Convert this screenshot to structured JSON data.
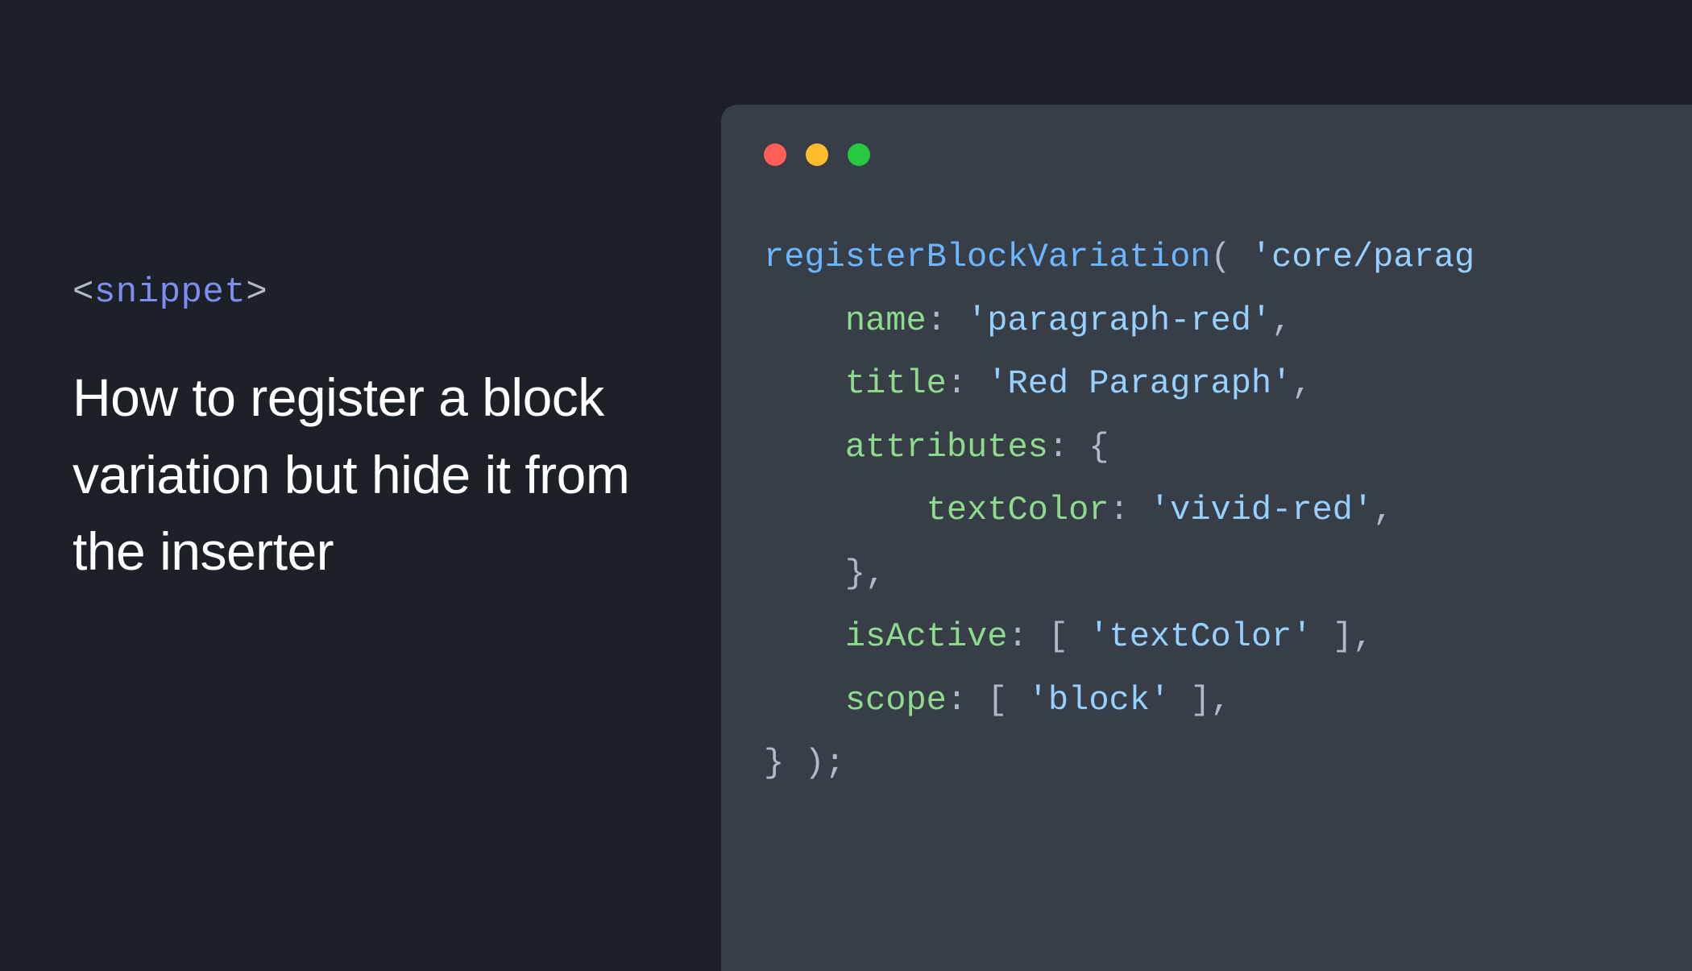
{
  "left": {
    "tag_open": "<",
    "tag_name": "snippet",
    "tag_close": ">",
    "heading": "How to register a block variation but hide it from the inserter"
  },
  "code": {
    "fn": "registerBlockVariation",
    "open_paren": "( ",
    "arg0": "'core/parag",
    "line2_key": "name",
    "line2_val": "'paragraph-red'",
    "line3_key": "title",
    "line3_val": "'Red Paragraph'",
    "line4_key": "attributes",
    "line4_open": "{",
    "line5_key": "textColor",
    "line5_val": "'vivid-red'",
    "line6_close": "},",
    "line7_key": "isActive",
    "line7_open": "[ ",
    "line7_val": "'textColor'",
    "line7_close": " ],",
    "line8_key": "scope",
    "line8_open": "[ ",
    "line8_val": "'block'",
    "line8_close": " ],",
    "line9": "} );",
    "colon": ": ",
    "comma": ","
  },
  "colors": {
    "bg": "#1c2128",
    "window": "#373e47",
    "fn": "#6cb6ff",
    "str": "#96d0ff",
    "key": "#8ddb8c",
    "punc": "#adbac7",
    "tag": "#7d8ef0"
  }
}
